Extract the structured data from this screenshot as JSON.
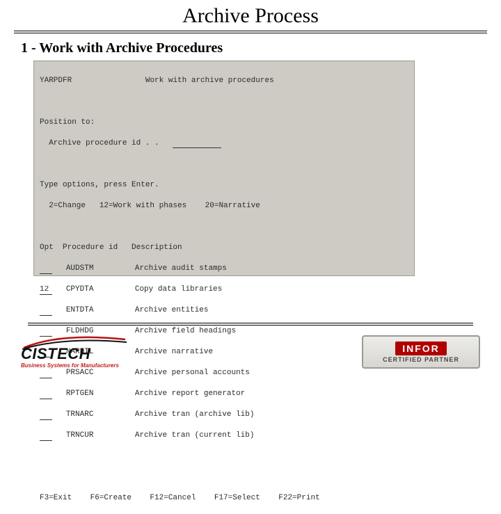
{
  "slide": {
    "title": "Archive Process",
    "subtitle": "1 - Work with Archive Procedures"
  },
  "terminal": {
    "program": "YARPDFR",
    "screen_title": "Work with archive procedures",
    "position_label": "Position to:",
    "position_field": "Archive procedure id . .",
    "type_line": "Type options, press Enter.",
    "opts_line": "  2=Change   12=Work with phases    20=Narrative",
    "col_opt": "Opt",
    "col_proc": "Procedure id",
    "col_desc": "Description",
    "rows": [
      {
        "opt": "",
        "id": "AUDSTM",
        "desc": "Archive audit stamps"
      },
      {
        "opt": "12",
        "id": "CPYDTA",
        "desc": "Copy data libraries"
      },
      {
        "opt": "",
        "id": "ENTDTA",
        "desc": "Archive entities"
      },
      {
        "opt": "",
        "id": "FLDHDG",
        "desc": "Archive field headings"
      },
      {
        "opt": "",
        "id": "NARDTL",
        "desc": "Archive narrative"
      },
      {
        "opt": "",
        "id": "PRSACC",
        "desc": "Archive personal accounts"
      },
      {
        "opt": "",
        "id": "RPTGEN",
        "desc": "Archive report generator"
      },
      {
        "opt": "",
        "id": "TRNARC",
        "desc": "Archive tran (archive lib)"
      },
      {
        "opt": "",
        "id": "TRNCUR",
        "desc": "Archive tran (current lib)"
      }
    ],
    "fkeys": "F3=Exit    F6=Create    F12=Cancel    F17=Select    F22=Print"
  },
  "logos": {
    "cistech_name": "CISTECH",
    "cistech_tag": "Business Systems for Manufacturers",
    "infor_name": "INFOR",
    "infor_cert": "CERTIFIED PARTNER"
  }
}
